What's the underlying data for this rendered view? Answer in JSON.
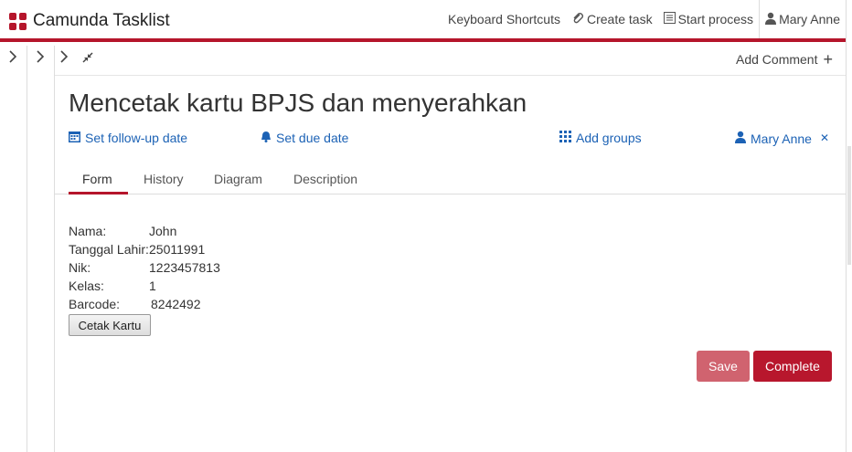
{
  "header": {
    "app_title": "Camunda Tasklist",
    "nav": {
      "keyboard_shortcuts": "Keyboard Shortcuts",
      "create_task": "Create task",
      "start_process": "Start process",
      "user": "Mary Anne"
    }
  },
  "toolbar": {
    "add_comment": "Add Comment"
  },
  "task": {
    "title": "Mencetak kartu BPJS dan menyerahkan",
    "actions": {
      "follow_up": "Set follow-up date",
      "due_date": "Set due date",
      "add_groups": "Add groups",
      "assignee": "Mary Anne"
    },
    "tabs": [
      "Form",
      "History",
      "Diagram",
      "Description"
    ],
    "active_tab": "Form"
  },
  "form": {
    "fields": [
      {
        "label": "Nama:",
        "value": "John"
      },
      {
        "label": "Tanggal Lahir:",
        "value": "25011991"
      },
      {
        "label": "Nik:",
        "value": "1223457813"
      },
      {
        "label": "Kelas:",
        "value": "1"
      },
      {
        "label": "Barcode:",
        "value": "8242492"
      }
    ],
    "cetak_button": "Cetak Kartu",
    "save_button": "Save",
    "complete_button": "Complete"
  },
  "colors": {
    "brand": "#b5152b",
    "link": "#1c62b5",
    "save_disabled": "#d0636f",
    "complete": "#b8172d"
  },
  "icons": {
    "brand": "camunda-logo-icon",
    "create_task": "paperclip-icon",
    "start_process": "list-icon",
    "user": "user-icon",
    "calendar": "calendar-icon",
    "bell": "bell-icon",
    "groups": "grid-icon",
    "remove": "close-icon"
  }
}
